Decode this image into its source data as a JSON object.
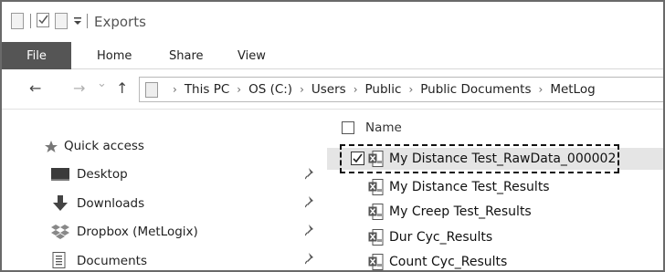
{
  "titlebar": {
    "title": "Exports",
    "quick_access_separator": "|"
  },
  "ribbon": {
    "tabs": [
      "File",
      "Home",
      "Share",
      "View"
    ]
  },
  "address": {
    "back_icon": "←",
    "forward_icon": "→",
    "history_icon": "⌄",
    "up_icon": "↑",
    "separator": "›",
    "crumbs": [
      "This PC",
      "OS (C:)",
      "Users",
      "Public",
      "Public Documents",
      "MetLog"
    ]
  },
  "navpane": {
    "quick_access": "Quick access",
    "items": [
      {
        "label": "Desktop",
        "icon": "desktop-icon",
        "pinned": true
      },
      {
        "label": "Downloads",
        "icon": "download-icon",
        "pinned": true
      },
      {
        "label": "Dropbox (MetLogix)",
        "icon": "dropbox-icon",
        "pinned": true
      },
      {
        "label": "Documents",
        "icon": "documents-icon",
        "pinned": true
      }
    ]
  },
  "filepane": {
    "column_name": "Name",
    "files": [
      {
        "name": "My Distance Test_RawData_000002",
        "selected": true,
        "checked": true
      },
      {
        "name": "My Distance Test_Results",
        "selected": false,
        "checked": false
      },
      {
        "name": "My Creep Test_Results",
        "selected": false,
        "checked": false
      },
      {
        "name": "Dur Cyc_Results",
        "selected": false,
        "checked": false
      },
      {
        "name": "Count Cyc_Results",
        "selected": false,
        "checked": false
      }
    ]
  },
  "colors": {
    "file_tab_bg": "#555555",
    "selection_bg": "#e5e5e5",
    "border": "#6a6a6a"
  }
}
